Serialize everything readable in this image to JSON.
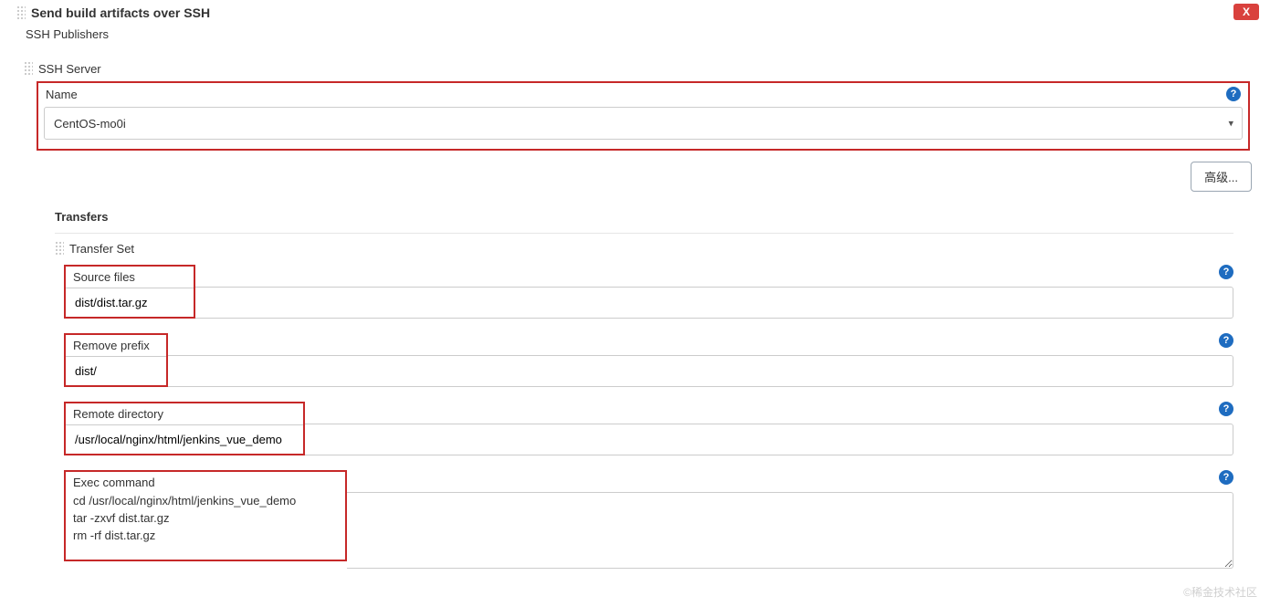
{
  "header": {
    "title": "Send build artifacts over SSH",
    "subtitle": "SSH Publishers",
    "close_label": "X"
  },
  "ssh_server": {
    "heading": "SSH Server",
    "name_label": "Name",
    "name_value": "CentOS-mo0i",
    "advanced_button": "高级..."
  },
  "transfers": {
    "heading": "Transfers",
    "set_heading": "Transfer Set",
    "source_files": {
      "label": "Source files",
      "value": "dist/dist.tar.gz"
    },
    "remove_prefix": {
      "label": "Remove prefix",
      "value": "dist/"
    },
    "remote_directory": {
      "label": "Remote directory",
      "value": "/usr/local/nginx/html/jenkins_vue_demo"
    },
    "exec_command": {
      "label": "Exec command",
      "value": "cd /usr/local/nginx/html/jenkins_vue_demo\ntar -zxvf dist.tar.gz\nrm -rf dist.tar.gz"
    }
  },
  "watermark": "©稀金技术社区"
}
